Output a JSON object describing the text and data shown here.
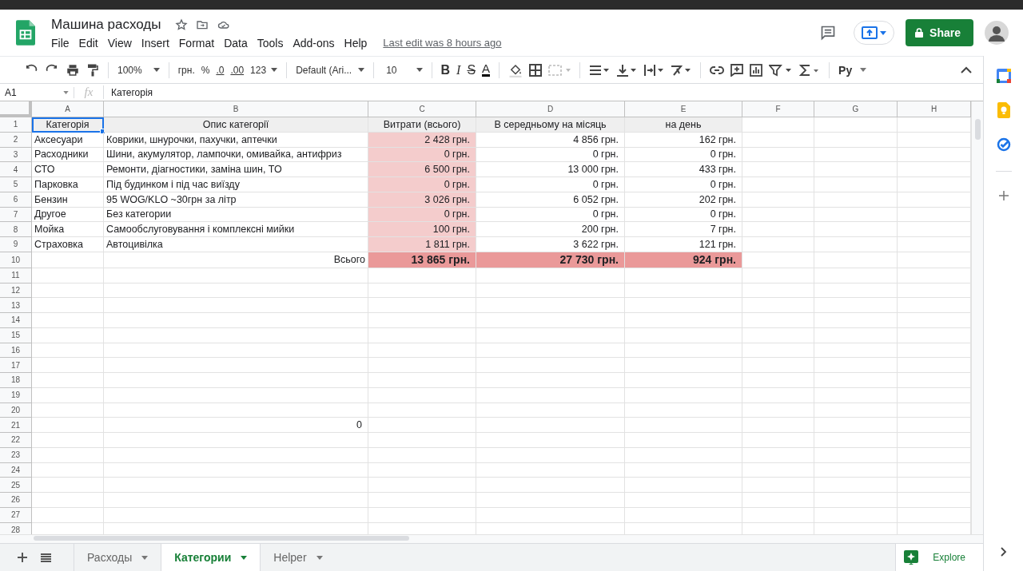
{
  "document": {
    "title": "Машина расходы",
    "last_edit": "Last edit was 8 hours ago",
    "share": "Share"
  },
  "menu": [
    "File",
    "Edit",
    "View",
    "Insert",
    "Format",
    "Data",
    "Tools",
    "Add-ons",
    "Help"
  ],
  "toolbar": {
    "zoom": "100%",
    "currency": "грн.",
    "percent": "%",
    "dec_less": ".0",
    "dec_more": ".00",
    "number_format": "123",
    "font": "Default (Ari...",
    "size": "10",
    "bold": "B",
    "italic": "I",
    "strike": "S",
    "text_color": "A",
    "input_tools": "Pу"
  },
  "formula_bar": {
    "cell": "A1",
    "fx": "fx",
    "value": "Категорія"
  },
  "columns": [
    "A",
    "B",
    "C",
    "D",
    "E",
    "F",
    "G",
    "H"
  ],
  "rows": [
    {
      "number": "1",
      "cells": [
        {
          "text": "Категорія",
          "kind": "header",
          "selected": true
        },
        {
          "text": "Опис категорії",
          "kind": "header",
          "selected": false
        },
        {
          "text": "Витрати (всього)",
          "kind": "header",
          "selected": false
        },
        {
          "text": "В середньому на місяць",
          "kind": "header",
          "selected": false
        },
        {
          "text": "на день",
          "kind": "header",
          "selected": false
        }
      ]
    },
    {
      "number": "2",
      "cells": [
        {
          "text": "Аксесуари",
          "kind": "text",
          "selected": false
        },
        {
          "text": "Коврики, шнурочки, пахучки, аптечки",
          "kind": "text",
          "selected": false
        },
        {
          "text": "2 428 грн.",
          "kind": "highlight",
          "selected": false
        },
        {
          "text": "4 856 грн.",
          "kind": "amount",
          "selected": false
        },
        {
          "text": "162 грн.",
          "kind": "amount",
          "selected": false
        }
      ]
    },
    {
      "number": "3",
      "cells": [
        {
          "text": "Расходники",
          "kind": "text",
          "selected": false
        },
        {
          "text": "Шини, акумулятор, лампочки, омивайка, антифриз",
          "kind": "text",
          "selected": false
        },
        {
          "text": "0 грн.",
          "kind": "highlight",
          "selected": false
        },
        {
          "text": "0 грн.",
          "kind": "amount",
          "selected": false
        },
        {
          "text": "0 грн.",
          "kind": "amount",
          "selected": false
        }
      ]
    },
    {
      "number": "4",
      "cells": [
        {
          "text": "СТО",
          "kind": "text",
          "selected": false
        },
        {
          "text": "Ремонти, діагностики, заміна шин, ТО",
          "kind": "text",
          "selected": false
        },
        {
          "text": "6 500 грн.",
          "kind": "highlight",
          "selected": false
        },
        {
          "text": "13 000 грн.",
          "kind": "amount",
          "selected": false
        },
        {
          "text": "433 грн.",
          "kind": "amount",
          "selected": false
        }
      ]
    },
    {
      "number": "5",
      "cells": [
        {
          "text": "Парковка",
          "kind": "text",
          "selected": false
        },
        {
          "text": "Під будинком і під час виїзду",
          "kind": "text",
          "selected": false
        },
        {
          "text": "0 грн.",
          "kind": "highlight",
          "selected": false
        },
        {
          "text": "0 грн.",
          "kind": "amount",
          "selected": false
        },
        {
          "text": "0 грн.",
          "kind": "amount",
          "selected": false
        }
      ]
    },
    {
      "number": "6",
      "cells": [
        {
          "text": "Бензин",
          "kind": "text",
          "selected": false
        },
        {
          "text": "95 WOG/KLO ~30грн за літр",
          "kind": "text",
          "selected": false
        },
        {
          "text": "3 026 грн.",
          "kind": "highlight",
          "selected": false
        },
        {
          "text": "6 052 грн.",
          "kind": "amount",
          "selected": false
        },
        {
          "text": "202 грн.",
          "kind": "amount",
          "selected": false
        }
      ]
    },
    {
      "number": "7",
      "cells": [
        {
          "text": "Другое",
          "kind": "text",
          "selected": false
        },
        {
          "text": "Без категории",
          "kind": "text",
          "selected": false
        },
        {
          "text": "0 грн.",
          "kind": "highlight",
          "selected": false
        },
        {
          "text": "0 грн.",
          "kind": "amount",
          "selected": false
        },
        {
          "text": "0 грн.",
          "kind": "amount",
          "selected": false
        }
      ]
    },
    {
      "number": "8",
      "cells": [
        {
          "text": "Мойка",
          "kind": "text",
          "selected": false
        },
        {
          "text": "Самообслуговування і комплексні мийки",
          "kind": "text",
          "selected": false
        },
        {
          "text": "100 грн.",
          "kind": "highlight",
          "selected": false
        },
        {
          "text": "200 грн.",
          "kind": "amount",
          "selected": false
        },
        {
          "text": "7 грн.",
          "kind": "amount",
          "selected": false
        }
      ]
    },
    {
      "number": "9",
      "cells": [
        {
          "text": "Страховка",
          "kind": "text",
          "selected": false
        },
        {
          "text": "Автоцивілка",
          "kind": "text",
          "selected": false
        },
        {
          "text": "1 811 грн.",
          "kind": "highlight",
          "selected": false
        },
        {
          "text": "3 622 грн.",
          "kind": "amount",
          "selected": false
        },
        {
          "text": "121 грн.",
          "kind": "amount",
          "selected": false
        }
      ]
    },
    {
      "number": "10",
      "cells": [
        {
          "kind": "blank",
          "selected": false
        },
        {
          "text": "Всього",
          "kind": "total_label",
          "selected": false
        },
        {
          "text": "13 865 грн.",
          "kind": "total",
          "selected": false
        },
        {
          "text": "27 730 грн.",
          "kind": "total",
          "selected": false
        },
        {
          "text": "924 грн.",
          "kind": "total",
          "selected": false
        }
      ]
    },
    {
      "number": "11",
      "cells": []
    },
    {
      "number": "12",
      "cells": []
    },
    {
      "number": "13",
      "cells": []
    },
    {
      "number": "14",
      "cells": []
    },
    {
      "number": "15",
      "cells": []
    },
    {
      "number": "16",
      "cells": []
    },
    {
      "number": "17",
      "cells": []
    },
    {
      "number": "18",
      "cells": []
    },
    {
      "number": "19",
      "cells": []
    },
    {
      "number": "20",
      "cells": []
    },
    {
      "number": "21",
      "cells": [
        {
          "kind": "blank",
          "selected": false
        },
        {
          "text": "0",
          "kind": "amount",
          "selected": false
        }
      ]
    },
    {
      "number": "22",
      "cells": []
    },
    {
      "number": "23",
      "cells": []
    },
    {
      "number": "24",
      "cells": []
    },
    {
      "number": "25",
      "cells": []
    },
    {
      "number": "26",
      "cells": []
    },
    {
      "number": "27",
      "cells": []
    },
    {
      "number": "28",
      "cells": []
    }
  ],
  "sheets": [
    {
      "label": "Расходы",
      "selected": false
    },
    {
      "label": "Категории",
      "selected": true
    },
    {
      "label": "Helper",
      "selected": false
    }
  ],
  "explore": "Explore"
}
